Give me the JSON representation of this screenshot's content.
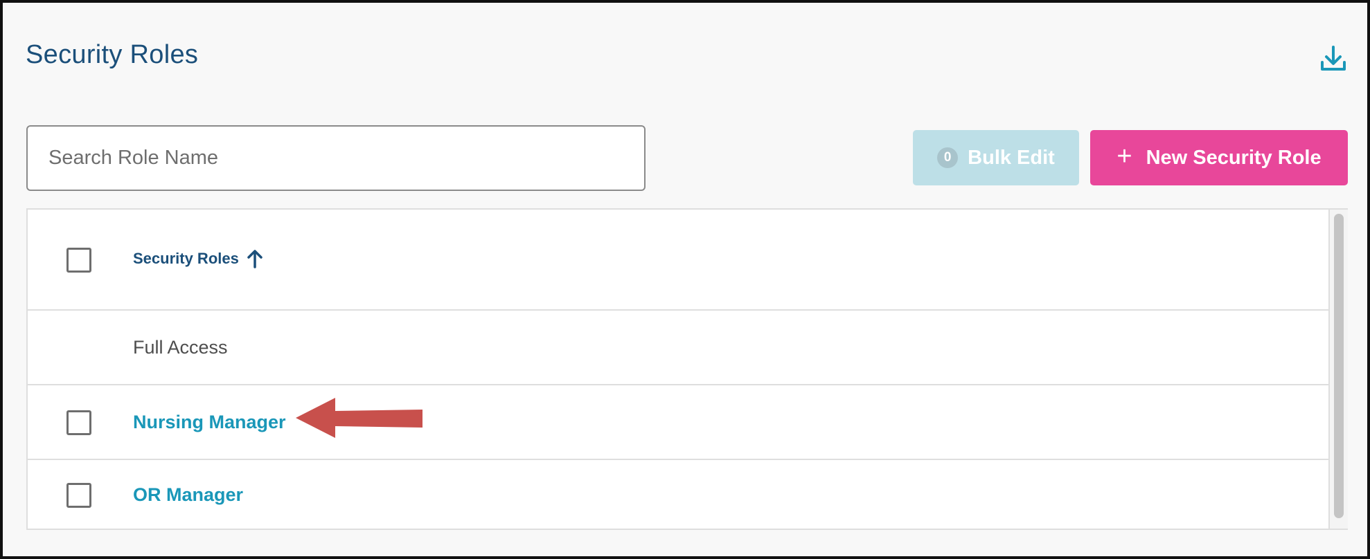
{
  "page": {
    "title": "Security Roles"
  },
  "toolbar": {
    "download_icon": "download-icon",
    "search_placeholder": "Search Role Name",
    "search_value": "",
    "bulk_edit_count": "0",
    "bulk_edit_label": "Bulk Edit",
    "new_role_icon": "plus-icon",
    "new_role_label": "New Security Role"
  },
  "table": {
    "column_header": "Security Roles",
    "sort_icon": "arrow-up-icon",
    "rows": [
      {
        "label": "Full Access",
        "selectable": false,
        "link": false
      },
      {
        "label": "Nursing Manager",
        "selectable": true,
        "link": true
      },
      {
        "label": "OR Manager",
        "selectable": true,
        "link": true
      }
    ]
  },
  "annotation": {
    "icon": "red-arrow-icon",
    "color": "#c8504c"
  },
  "colors": {
    "title": "#1b4f7a",
    "link": "#1a97b8",
    "primary_button": "#e8479a",
    "disabled_button": "#bddfe7"
  }
}
